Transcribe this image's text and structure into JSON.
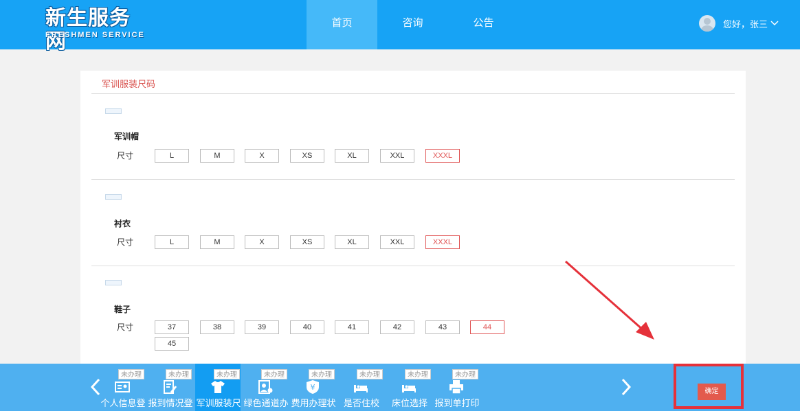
{
  "header": {
    "logo_cn": "新生服务网",
    "logo_en": "FRESHMEN SERVICE",
    "nav": [
      {
        "label": "首页",
        "active": true
      },
      {
        "label": "咨询",
        "active": false
      },
      {
        "label": "公告",
        "active": false
      }
    ],
    "user_greeting": "您好，张三",
    "user_dropdown_icon": "chevron-down-icon"
  },
  "panel": {
    "title": "军训服装尺码",
    "size_label": "尺寸",
    "sections": [
      {
        "name": "军训帽",
        "options": [
          "L",
          "M",
          "X",
          "XS",
          "XL",
          "XXL",
          "XXXL"
        ],
        "selected": "XXXL"
      },
      {
        "name": "衬衣",
        "options": [
          "L",
          "M",
          "X",
          "XS",
          "XL",
          "XXL",
          "XXXL"
        ],
        "selected": "XXXL"
      },
      {
        "name": "鞋子",
        "options": [
          "37",
          "38",
          "39",
          "40",
          "41",
          "42",
          "43",
          "44",
          "45"
        ],
        "selected": "44"
      }
    ]
  },
  "steps": [
    {
      "label": "个人信息登",
      "badge": "未办理",
      "icon": "id-card-icon",
      "active": false
    },
    {
      "label": "报到情况登",
      "badge": "未办理",
      "icon": "edit-document-icon",
      "active": false
    },
    {
      "label": "军训服装尺",
      "badge": "未办理",
      "icon": "shirt-icon",
      "active": true
    },
    {
      "label": "绿色通道办",
      "badge": "未办理",
      "icon": "person-card-icon",
      "active": false
    },
    {
      "label": "费用办理状",
      "badge": "未办理",
      "icon": "yuan-shield-icon",
      "active": false
    },
    {
      "label": "是否住校",
      "badge": "未办理",
      "icon": "bed-icon",
      "active": false
    },
    {
      "label": "床位选择",
      "badge": "未办理",
      "icon": "bed-icon",
      "active": false
    },
    {
      "label": "报到单打印",
      "badge": "未办理",
      "icon": "printer-icon",
      "active": false
    }
  ],
  "confirm_label": "确定",
  "colors": {
    "header_bg": "#17a3f5",
    "nav_active_bg": "#45b9f9",
    "bottom_bar_bg": "#4fb0f0",
    "accent_red": "#e05555",
    "highlight_box": "#e5313a"
  }
}
